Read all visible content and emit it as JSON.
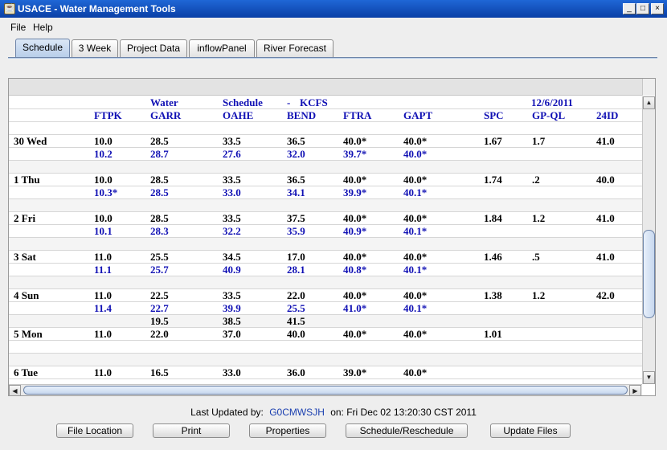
{
  "window": {
    "app_icon": "java-cup-icon",
    "title": "USACE - Water Management Tools"
  },
  "menu": [
    "File",
    "Help"
  ],
  "tabs": [
    "Schedule",
    "3 Week",
    "Project Data",
    "inflowPanel",
    "River Forecast"
  ],
  "active_tab": "Schedule",
  "table": {
    "title_row": {
      "water": "Water",
      "schedule": "Schedule",
      "dash": "-",
      "units": "KCFS",
      "date": "12/6/2011"
    },
    "columns": [
      "",
      "FTPK",
      "GARR",
      "OAHE",
      "BEND",
      "FTRA",
      "GAPT",
      "SPC",
      "GP-QL",
      "24ID"
    ],
    "rows": [
      {
        "color": "black",
        "cells": [
          "30 Wed",
          "10.0",
          "28.5",
          "33.5",
          "36.5",
          "40.0*",
          "40.0*",
          "1.67",
          "1.7",
          "41.0"
        ]
      },
      {
        "color": "blue",
        "cells": [
          "",
          "10.2",
          "28.7",
          "27.6",
          "32.0",
          "39.7*",
          "40.0*",
          "",
          "",
          ""
        ]
      },
      {
        "color": "black",
        "cells": [
          "",
          "",
          "",
          "",
          "",
          "",
          "",
          "",
          "",
          ""
        ]
      },
      {
        "color": "black",
        "cells": [
          "1 Thu",
          "10.0",
          "28.5",
          "33.5",
          "36.5",
          "40.0*",
          "40.0*",
          "1.74",
          ".2",
          "40.0"
        ]
      },
      {
        "color": "blue",
        "cells": [
          "",
          "10.3*",
          "28.5",
          "33.0",
          "34.1",
          "39.9*",
          "40.1*",
          "",
          "",
          ""
        ]
      },
      {
        "color": "black",
        "cells": [
          "",
          "",
          "",
          "",
          "",
          "",
          "",
          "",
          "",
          ""
        ]
      },
      {
        "color": "black",
        "cells": [
          "2 Fri",
          "10.0",
          "28.5",
          "33.5",
          "37.5",
          "40.0*",
          "40.0*",
          "1.84",
          "1.2",
          "41.0"
        ]
      },
      {
        "color": "blue",
        "cells": [
          "",
          "10.1",
          "28.3",
          "32.2",
          "35.9",
          "40.9*",
          "40.1*",
          "",
          "",
          ""
        ]
      },
      {
        "color": "black",
        "cells": [
          "",
          "",
          "",
          "",
          "",
          "",
          "",
          "",
          "",
          ""
        ]
      },
      {
        "color": "black",
        "cells": [
          "3 Sat",
          "11.0",
          "25.5",
          "34.5",
          "17.0",
          "40.0*",
          "40.0*",
          "1.46",
          ".5",
          "41.0"
        ]
      },
      {
        "color": "blue",
        "cells": [
          "",
          "11.1",
          "25.7",
          "40.9",
          "28.1",
          "40.8*",
          "40.1*",
          "",
          "",
          ""
        ]
      },
      {
        "color": "black",
        "cells": [
          "",
          "",
          "",
          "",
          "",
          "",
          "",
          "",
          "",
          ""
        ]
      },
      {
        "color": "black",
        "cells": [
          "4 Sun",
          "11.0",
          "22.5",
          "33.5",
          "22.0",
          "40.0*",
          "40.0*",
          "1.38",
          "1.2",
          "42.0"
        ]
      },
      {
        "color": "blue",
        "cells": [
          "",
          "11.4",
          "22.7",
          "39.9",
          "25.5",
          "41.0*",
          "40.1*",
          "",
          "",
          ""
        ]
      },
      {
        "color": "black",
        "cells": [
          "",
          "",
          "19.5",
          "38.5",
          "41.5",
          "",
          "",
          "",
          "",
          ""
        ]
      },
      {
        "color": "black",
        "cells": [
          "5 Mon",
          "11.0",
          "22.0",
          "37.0",
          "40.0",
          "40.0*",
          "40.0*",
          "1.01",
          "",
          ""
        ]
      },
      {
        "color": "black",
        "cells": [
          "",
          "",
          "",
          "",
          "",
          "",
          "",
          "",
          "",
          ""
        ]
      },
      {
        "color": "black",
        "cells": [
          "",
          "",
          "",
          "",
          "",
          "",
          "",
          "",
          "",
          ""
        ]
      },
      {
        "color": "black",
        "cells": [
          "6 Tue",
          "11.0",
          "16.5",
          "33.0",
          "36.0",
          "39.0*",
          "40.0*",
          "",
          "",
          ""
        ]
      }
    ]
  },
  "footer": {
    "last_updated_label": "Last Updated by:",
    "user": "G0CMWSJH",
    "on_label": "on: Fri Dec 02 13:20:30 CST 2011"
  },
  "buttons": [
    "File Location",
    "Print",
    "Properties",
    "Schedule/Reschedule",
    "Update Files"
  ],
  "colors": {
    "title_bar": "#1f67d6",
    "blue_values": "#1010b4",
    "active_tab": "#b7cde9"
  }
}
